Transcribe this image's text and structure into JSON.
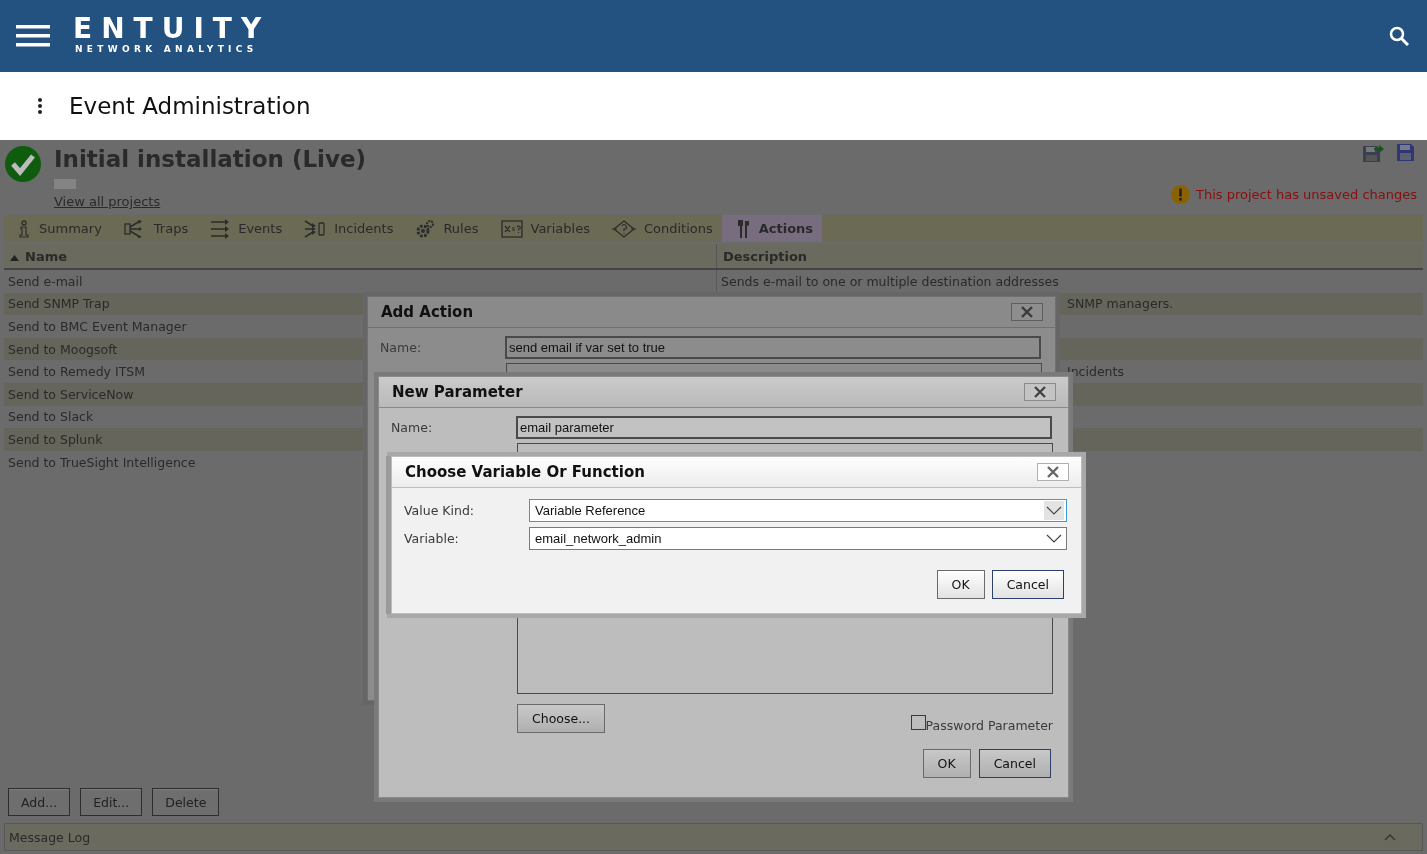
{
  "header": {
    "logo": "ENTUITY",
    "tagline": "NETWORK ANALYTICS"
  },
  "page_title": "Event Administration",
  "project": {
    "title": "Initial installation (Live)",
    "link": "View all projects",
    "warning": "This project has unsaved changes"
  },
  "tabs": [
    {
      "label": "Summary",
      "selected": false
    },
    {
      "label": "Traps",
      "selected": false
    },
    {
      "label": "Events",
      "selected": false
    },
    {
      "label": "Incidents",
      "selected": false
    },
    {
      "label": "Rules",
      "selected": false
    },
    {
      "label": "Variables",
      "selected": false
    },
    {
      "label": "Conditions",
      "selected": false
    },
    {
      "label": "Actions",
      "selected": true
    }
  ],
  "table": {
    "columns": [
      {
        "label": "Name",
        "sorted": true
      },
      {
        "label": "Description",
        "sorted": false
      }
    ],
    "rows": [
      {
        "name": "Send e-mail",
        "description": "Sends e-mail to one or multiple destination addresses",
        "kind": "full"
      },
      {
        "name": "Send SNMP Trap",
        "description": "SNMP managers.",
        "kind": "partial"
      },
      {
        "name": "Send to BMC Event Manager"
      },
      {
        "name": "Send to Moogsoft"
      },
      {
        "name": "Send to Remedy ITSM",
        "description": "Incidents",
        "kind": "partial"
      },
      {
        "name": "Send to ServiceNow"
      },
      {
        "name": "Send to Slack"
      },
      {
        "name": "Send to Splunk"
      },
      {
        "name": "Send to TrueSight Intelligence"
      }
    ]
  },
  "buttons": [
    "Add...",
    "Edit...",
    "Delete"
  ],
  "message_log": "Message Log",
  "add_action": {
    "title": "Add Action",
    "fields": [
      {
        "label": "Name:",
        "value": "send email if var set to true"
      }
    ]
  },
  "new_parameter": {
    "title": "New Parameter",
    "fields": [
      {
        "label": "Name:",
        "value": "email parameter"
      }
    ],
    "choose_button": "Choose...",
    "password": {
      "label": "Password Parameter",
      "checked": false
    },
    "buttons": [
      "OK",
      "Cancel"
    ]
  },
  "choose_variable": {
    "title": "Choose Variable Or Function",
    "fields": [
      {
        "label": "Value Kind:",
        "value": "Variable Reference",
        "focused": true
      },
      {
        "label": "Variable:",
        "value": "email_network_admin",
        "focused": false
      }
    ],
    "buttons": [
      "OK",
      "Cancel"
    ]
  }
}
